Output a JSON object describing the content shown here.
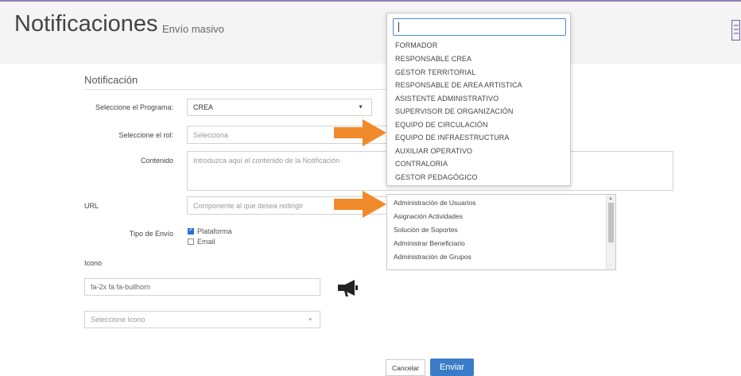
{
  "header": {
    "title": "Notificaciones",
    "subtitle": "Envío masivo"
  },
  "form": {
    "section_title": "Notificación",
    "programa_label": "Seleccione el Programa:",
    "programa_value": "CREA",
    "rol_label": "Seleccione el rol:",
    "rol_placeholder": "Selecciona",
    "contenido_label": "Contenido",
    "contenido_placeholder": "Introduzca aquí el contenido de la Notificación",
    "url_label": "URL",
    "url_placeholder": "Componente al que desea redirigir",
    "tipo_envio_label": "Tipo de Envío",
    "tipo_plataforma": "Plataforma",
    "tipo_email": "Email",
    "icono_label": "Icono",
    "icono_value": "fa-2x fa fa-bullhorn",
    "icono_select_placeholder": "Seleccione Icono"
  },
  "rol_dropdown": {
    "options": [
      "FORMADOR",
      "RESPONSABLE CREA",
      "GESTOR TERRITORIAL",
      "RESPONSABLE DE AREA ARTISTICA",
      "ASISTENTE ADMINISTRATIVO",
      "SUPERVISOR DE ORGANIZACIÓN",
      "EQUIPO DE CIRCULACIÓN",
      "EQUIPO DE INFRAESTRUCTURA",
      "AUXILIAR OPERATIVO",
      "CONTRALORIA",
      "GESTOR PEDAGÓGICO"
    ]
  },
  "url_list": {
    "options": [
      "Administración de Usuarios",
      "Asignación Actividades",
      "Solución de Soportes",
      "Administrar Beneficiario",
      "Administración de Grupos"
    ]
  },
  "actions": {
    "cancel": "Cancelar",
    "send": "Enviar"
  },
  "colors": {
    "accent": "#3b7cc9",
    "arrow": "#f08a2a",
    "header_bg": "#f4f4f4"
  }
}
